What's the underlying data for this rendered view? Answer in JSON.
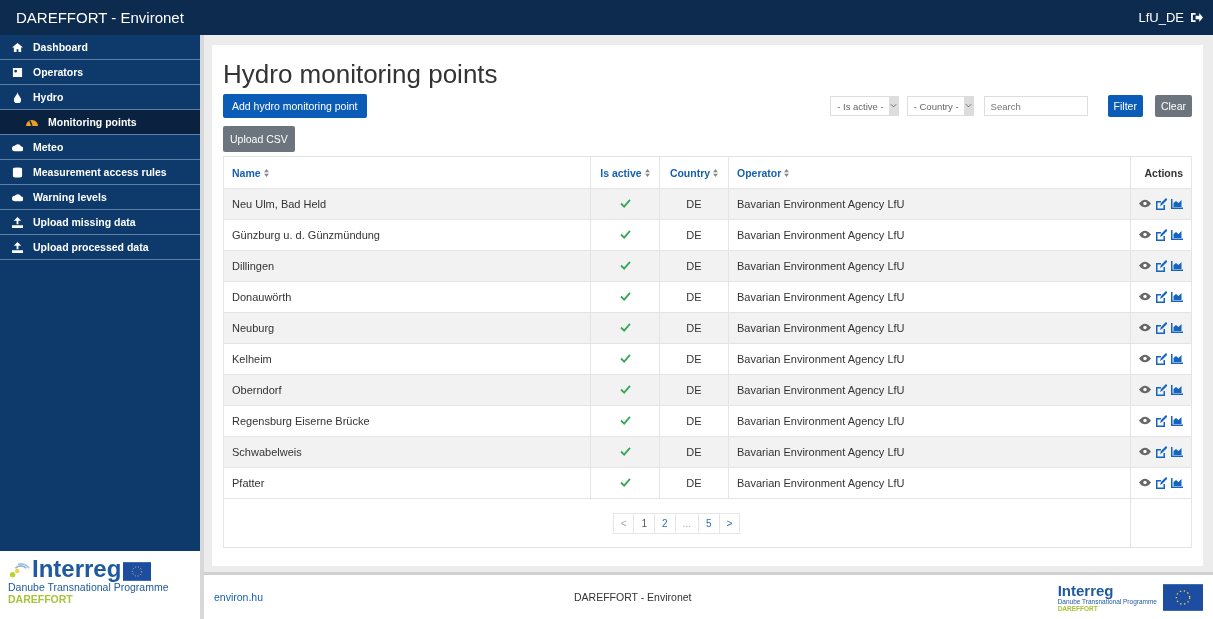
{
  "app_title": "DAREFFORT - Environet",
  "user": "LfU_DE",
  "sidebar": {
    "items": [
      {
        "label": "Dashboard",
        "kind": "home",
        "selected": false
      },
      {
        "label": "Operators",
        "kind": "card",
        "selected": false
      },
      {
        "label": "Hydro",
        "kind": "drop",
        "selected": false,
        "children": [
          {
            "label": "Monitoring points",
            "selected": true
          }
        ]
      },
      {
        "label": "Meteo",
        "kind": "cloud",
        "selected": false
      },
      {
        "label": "Measurement access rules",
        "kind": "db",
        "selected": false
      },
      {
        "label": "Warning levels",
        "kind": "cloud",
        "selected": false
      },
      {
        "label": "Upload missing data",
        "kind": "upload",
        "selected": false
      },
      {
        "label": "Upload processed data",
        "kind": "upload",
        "selected": false
      }
    ],
    "logo": {
      "name": "Interreg",
      "programme": "Danube Transnational Programme",
      "project": "DAREFFORT"
    }
  },
  "page_title": "Hydro monitoring points",
  "buttons": {
    "add": "Add hydro monitoring point",
    "upload": "Upload CSV"
  },
  "filters": {
    "active_select": "- Is active -",
    "country_select": "- Country -",
    "search_placeholder": "Search",
    "filter": "Filter",
    "clear": "Clear"
  },
  "table": {
    "columns": [
      {
        "label": "Name",
        "sortable": true
      },
      {
        "label": "Is active",
        "sortable": true
      },
      {
        "label": "Country",
        "sortable": true
      },
      {
        "label": "Operator",
        "sortable": true
      },
      {
        "label": "Actions",
        "sortable": false
      }
    ],
    "rows": [
      {
        "name": "Neu Ulm, Bad Held",
        "active": true,
        "country": "DE",
        "operator": "Bavarian Environment Agency LfU"
      },
      {
        "name": "Günzburg u. d. Günzmündung",
        "active": true,
        "country": "DE",
        "operator": "Bavarian Environment Agency LfU"
      },
      {
        "name": "Dillingen",
        "active": true,
        "country": "DE",
        "operator": "Bavarian Environment Agency LfU"
      },
      {
        "name": "Donauwörth",
        "active": true,
        "country": "DE",
        "operator": "Bavarian Environment Agency LfU"
      },
      {
        "name": "Neuburg",
        "active": true,
        "country": "DE",
        "operator": "Bavarian Environment Agency LfU"
      },
      {
        "name": "Kelheim",
        "active": true,
        "country": "DE",
        "operator": "Bavarian Environment Agency LfU"
      },
      {
        "name": "Oberndorf",
        "active": true,
        "country": "DE",
        "operator": "Bavarian Environment Agency LfU"
      },
      {
        "name": "Regensburg Eiserne Brücke",
        "active": true,
        "country": "DE",
        "operator": "Bavarian Environment Agency LfU"
      },
      {
        "name": "Schwabelweis",
        "active": true,
        "country": "DE",
        "operator": "Bavarian Environment Agency LfU"
      },
      {
        "name": "Pfatter",
        "active": true,
        "country": "DE",
        "operator": "Bavarian Environment Agency LfU"
      }
    ]
  },
  "pagination": [
    {
      "label": "<",
      "selected": false,
      "disabled": true
    },
    {
      "label": "1",
      "selected": true,
      "disabled": false
    },
    {
      "label": "2",
      "selected": false,
      "disabled": false
    },
    {
      "label": "...",
      "selected": false,
      "disabled": true
    },
    {
      "label": "5",
      "selected": false,
      "disabled": false
    },
    {
      "label": ">",
      "selected": false,
      "disabled": false
    }
  ],
  "footer": {
    "link": "environ.hu",
    "center": "DAREFFORT - Environet",
    "logo": {
      "name": "Interreg",
      "programme": "Danube Transnational Programme",
      "project": "DAREFFORT"
    }
  }
}
